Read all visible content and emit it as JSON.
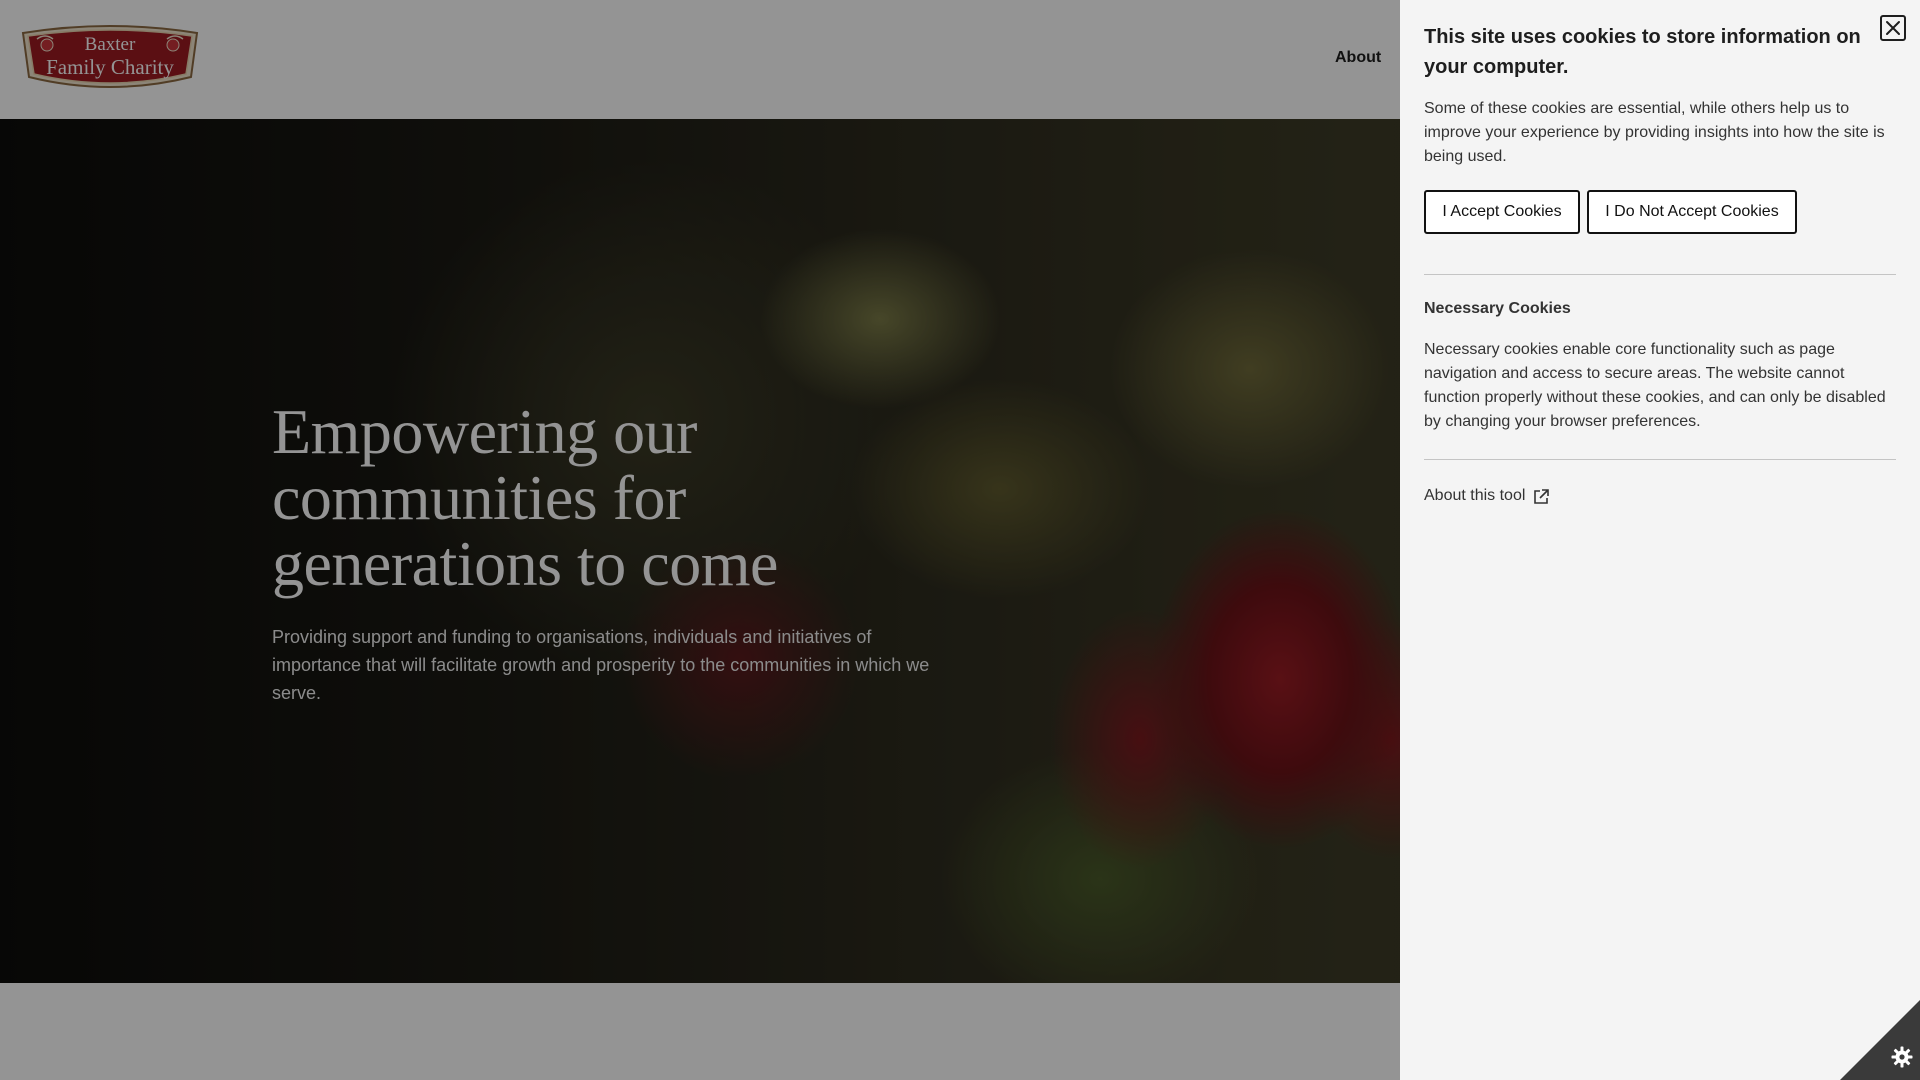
{
  "header": {
    "logo_line1": "Baxter",
    "logo_line2": "Family Charity",
    "nav_about": "About"
  },
  "hero": {
    "title": "Empowering our communities for generations to come",
    "subtitle": "Providing support and funding to organisations, individuals and initiatives of importance that will facilitate growth and prosperity to the communities in which we serve."
  },
  "cookie_panel": {
    "title": "This site uses cookies to store information on your computer.",
    "intro": "Some of these cookies are essential, while others help us to improve your experience by providing insights into how the site is being used.",
    "accept_label": "I Accept Cookies",
    "reject_label": "I Do Not Accept Cookies",
    "necessary_heading": "Necessary Cookies",
    "necessary_text": "Necessary cookies enable core functionality such as page navigation and access to secure areas. The website cannot function properly without these cookies, and can only be disabled by changing your browser preferences.",
    "about_tool_label": "About this tool",
    "close_icon": "close-icon",
    "external_link_icon": "external-link-icon",
    "settings_icon": "gear-icon"
  },
  "colors": {
    "brand_red": "#9e1b22",
    "panel_bg": "#f4f4f4",
    "overlay": "rgba(0,0,0,0.42)",
    "corner_dark": "#3a3a3a"
  }
}
